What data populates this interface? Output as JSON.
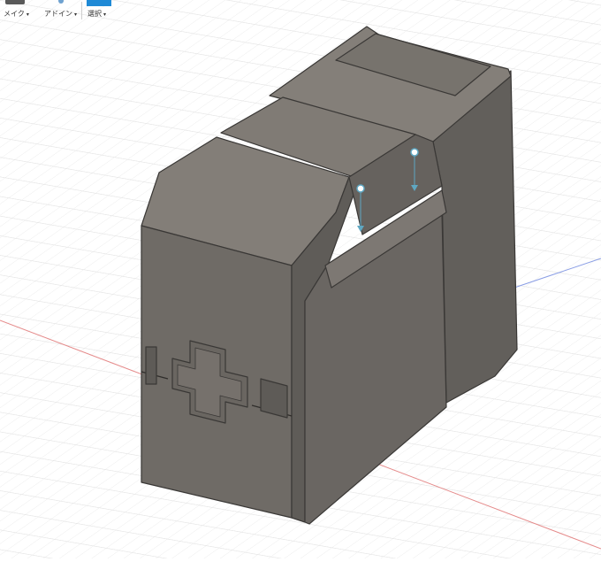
{
  "toolbar": {
    "make_label": "メイク",
    "addins_label": "アドイン",
    "select_label": "選択",
    "dropdown_glyph": "▾"
  },
  "viewport": {
    "background": "#ffffff",
    "grid_color": "#e0e0e0",
    "x_axis_color": "#e58a8a",
    "z_axis_color": "#8a9ee5",
    "model_colors": {
      "top": "#7f7a74",
      "front": "#6f6b66",
      "side": "#625f5b",
      "edge": "#3a3836"
    },
    "joint_color": "#5fa7c2"
  }
}
